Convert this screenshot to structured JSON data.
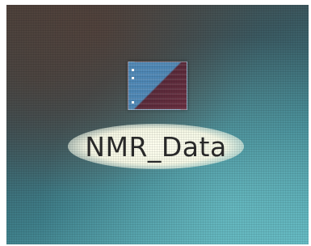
{
  "desktop": {
    "icons": [
      {
        "label": "NMR_Data",
        "icon": "image-file-icon",
        "selected": true
      }
    ]
  }
}
